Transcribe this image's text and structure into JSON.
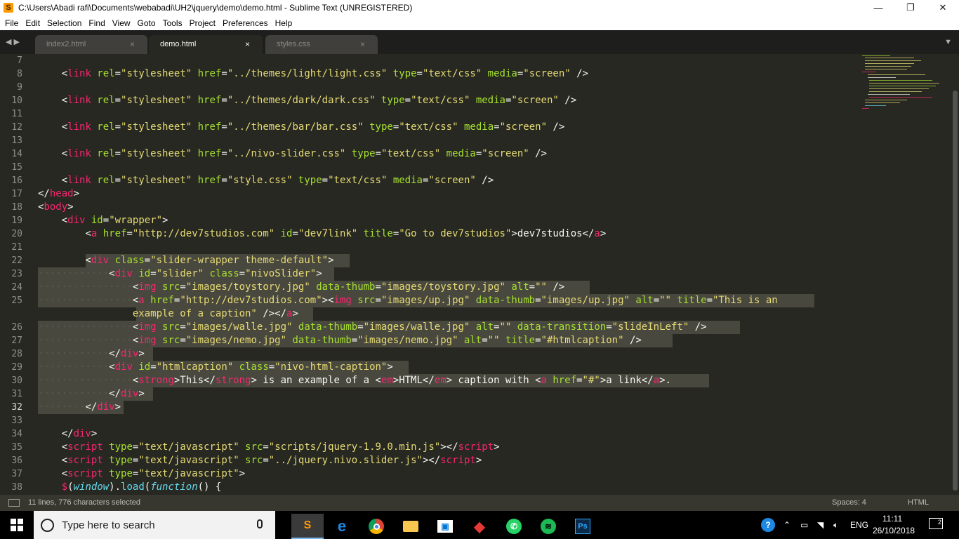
{
  "window": {
    "title": "C:\\Users\\Abadi rafi\\Documents\\webabadi\\UH2\\jquery\\demo\\demo.html - Sublime Text (UNREGISTERED)",
    "app_icon": "S",
    "minimize": "—",
    "maximize": "❐",
    "close": "✕"
  },
  "menu": [
    "File",
    "Edit",
    "Selection",
    "Find",
    "View",
    "Goto",
    "Tools",
    "Project",
    "Preferences",
    "Help"
  ],
  "tabs": [
    {
      "label": "index2.html",
      "close": "×",
      "active": false
    },
    {
      "label": "demo.html",
      "close": "×",
      "active": true
    },
    {
      "label": "styles.css",
      "close": "×",
      "active": false
    }
  ],
  "tab_nav": "◀▶",
  "tab_dropdown": "▼",
  "line_numbers": [
    "7",
    "8",
    "9",
    "10",
    "11",
    "12",
    "13",
    "14",
    "15",
    "16",
    "17",
    "18",
    "19",
    "20",
    "21",
    "22",
    "23",
    "24",
    "25",
    "",
    "26",
    "27",
    "28",
    "29",
    "30",
    "31",
    "32",
    "33",
    "34",
    "35",
    "36",
    "37",
    "38"
  ],
  "code": {
    "l8": {
      "i": "    ",
      "lt": "<",
      "tag": "link",
      "a1": " rel",
      "e1": "=",
      "v1": "\"stylesheet\"",
      "a2": " href",
      "e2": "=",
      "v2": "\"../themes/light/light.css\"",
      "a3": " type",
      "e3": "=",
      "v3": "\"text/css\"",
      "a4": " media",
      "e4": "=",
      "v4": "\"screen\"",
      "end": " />"
    },
    "l10": {
      "i": "    ",
      "lt": "<",
      "tag": "link",
      "a1": " rel",
      "e1": "=",
      "v1": "\"stylesheet\"",
      "a2": " href",
      "e2": "=",
      "v2": "\"../themes/dark/dark.css\"",
      "a3": " type",
      "e3": "=",
      "v3": "\"text/css\"",
      "a4": " media",
      "e4": "=",
      "v4": "\"screen\"",
      "end": " />"
    },
    "l12": {
      "i": "    ",
      "lt": "<",
      "tag": "link",
      "a1": " rel",
      "e1": "=",
      "v1": "\"stylesheet\"",
      "a2": " href",
      "e2": "=",
      "v2": "\"../themes/bar/bar.css\"",
      "a3": " type",
      "e3": "=",
      "v3": "\"text/css\"",
      "a4": " media",
      "e4": "=",
      "v4": "\"screen\"",
      "end": " />"
    },
    "l14": {
      "i": "    ",
      "lt": "<",
      "tag": "link",
      "a1": " rel",
      "e1": "=",
      "v1": "\"stylesheet\"",
      "a2": " href",
      "e2": "=",
      "v2": "\"../nivo-slider.css\"",
      "a3": " type",
      "e3": "=",
      "v3": "\"text/css\"",
      "a4": " media",
      "e4": "=",
      "v4": "\"screen\"",
      "end": " />"
    },
    "l16": {
      "i": "    ",
      "lt": "<",
      "tag": "link",
      "a1": " rel",
      "e1": "=",
      "v1": "\"stylesheet\"",
      "a2": " href",
      "e2": "=",
      "v2": "\"style.css\"",
      "a3": " type",
      "e3": "=",
      "v3": "\"text/css\"",
      "a4": " media",
      "e4": "=",
      "v4": "\"screen\"",
      "end": " />"
    },
    "l17": {
      "lt": "</",
      "tag": "head",
      "gt": ">"
    },
    "l18": {
      "lt": "<",
      "tag": "body",
      "gt": ">"
    },
    "l19": {
      "i": "    ",
      "lt": "<",
      "tag": "div",
      "a1": " id",
      "e1": "=",
      "v1": "\"wrapper\"",
      "gt": ">"
    },
    "l20": {
      "i": "        ",
      "lt": "<",
      "tag": "a",
      "a1": " href",
      "e1": "=",
      "v1": "\"http://dev7studios.com\"",
      "a2": " id",
      "e2": "=",
      "v2": "\"dev7link\"",
      "a3": " title",
      "e3": "=",
      "v3": "\"Go to dev7studios\"",
      "txt": ">dev7studios</",
      "tag2": "a",
      "gt": ">"
    },
    "l22": {
      "i": "        ",
      "lt": "<",
      "tag": "div",
      "a1": " class",
      "e1": "=",
      "v1": "\"slider-wrapper theme-default\"",
      "gt": ">"
    },
    "l23": {
      "i": "············",
      "lt": "<",
      "tag": "div",
      "a1": " id",
      "e1": "=",
      "v1": "\"slider\"",
      "a2": " class",
      "e2": "=",
      "v2": "\"nivoSlider\"",
      "gt": ">"
    },
    "l24": {
      "i": "················",
      "lt": "<",
      "tag": "img",
      "a1": " src",
      "e1": "=",
      "v1": "\"images/toystory.jpg\"",
      "a2": " data-thumb",
      "e2": "=",
      "v2": "\"images/toystory.jpg\"",
      "a3": " alt",
      "e3": "=",
      "v3": "\"\"",
      "end": " />"
    },
    "l25": {
      "i": "················",
      "lt": "<",
      "tag": "a",
      "a1": " href",
      "e1": "=",
      "v1": "\"http://dev7studios.com\"",
      "gt1": "><",
      "tag2": "img",
      "a2": " src",
      "e2": "=",
      "v2": "\"images/up.jpg\"",
      "a3": " data-thumb",
      "e3": "=",
      "v3": "\"images/up.jpg\"",
      "a4": " alt",
      "e4": "=",
      "v4": "\"\"",
      "a5": " title",
      "e5": "=",
      "v5": "\"This is an"
    },
    "l25b": {
      "i": "                ",
      "v": "example of a caption\"",
      "mid": " /></",
      "tag": "a",
      "gt": ">"
    },
    "l26": {
      "i": "················",
      "lt": "<",
      "tag": "img",
      "a1": " src",
      "e1": "=",
      "v1": "\"images/walle.jpg\"",
      "a2": " data-thumb",
      "e2": "=",
      "v2": "\"images/walle.jpg\"",
      "a3": " alt",
      "e3": "=",
      "v3": "\"\"",
      "a4": " data-transition",
      "e4": "=",
      "v4": "\"slideInLeft\"",
      "end": " />"
    },
    "l27": {
      "i": "················",
      "lt": "<",
      "tag": "img",
      "a1": " src",
      "e1": "=",
      "v1": "\"images/nemo.jpg\"",
      "a2": " data-thumb",
      "e2": "=",
      "v2": "\"images/nemo.jpg\"",
      "a3": " alt",
      "e3": "=",
      "v3": "\"\"",
      "a4": " title",
      "e4": "=",
      "v4": "\"#htmlcaption\"",
      "end": " />"
    },
    "l28": {
      "i": "············",
      "lt": "</",
      "tag": "div",
      "gt": ">"
    },
    "l29": {
      "i": "············",
      "lt": "<",
      "tag": "div",
      "a1": " id",
      "e1": "=",
      "v1": "\"htmlcaption\"",
      "a2": " class",
      "e2": "=",
      "v2": "\"nivo-html-caption\"",
      "gt": ">"
    },
    "l30": {
      "i": "················",
      "lt": "<",
      "tag": "strong",
      "t1": ">This</",
      "tag2": "strong",
      "t2": "> is an example of a <",
      "tag3": "em",
      "t3": ">HTML</",
      "tag4": "em",
      "t4": "> caption with <",
      "tag5": "a",
      "a1": " href",
      "e1": "=",
      "v1": "\"#\"",
      "t5": ">a link</",
      "tag6": "a",
      "t6": ">."
    },
    "l31": {
      "i": "············",
      "lt": "</",
      "tag": "div",
      "gt": ">"
    },
    "l32": {
      "i": "········",
      "lt": "</",
      "tag": "div",
      "gt": ">"
    },
    "l34": {
      "i": "    ",
      "lt": "</",
      "tag": "div",
      "gt": ">"
    },
    "l35": {
      "i": "    ",
      "lt": "<",
      "tag": "script",
      "a1": " type",
      "e1": "=",
      "v1": "\"text/javascript\"",
      "a2": " src",
      "e2": "=",
      "v2": "\"scripts/jquery-1.9.0.min.js\"",
      "mid": "></",
      "tag2": "script",
      "gt": ">"
    },
    "l36": {
      "i": "    ",
      "lt": "<",
      "tag": "script",
      "a1": " type",
      "e1": "=",
      "v1": "\"text/javascript\"",
      "a2": " src",
      "e2": "=",
      "v2": "\"../jquery.nivo.slider.js\"",
      "mid": "></",
      "tag2": "script",
      "gt": ">"
    },
    "l37": {
      "i": "    ",
      "lt": "<",
      "tag": "script",
      "a1": " type",
      "e1": "=",
      "v1": "\"text/javascript\"",
      "gt": ">"
    },
    "l38": {
      "i": "    ",
      "d": "$",
      "p1": "(",
      "w": "window",
      "p2": ").",
      "ld": "load",
      "p3": "(",
      "fn": "function",
      "p4": "() {"
    }
  },
  "status": {
    "selection": "11 lines, 776 characters selected",
    "spaces": "Spaces: 4",
    "syntax": "HTML"
  },
  "taskbar": {
    "search_placeholder": "Type here to search",
    "apps": [
      {
        "name": "sublime-text-icon",
        "glyph": "S",
        "color": "#ff9800",
        "active": true
      },
      {
        "name": "edge-icon",
        "glyph": "e",
        "color": "#1e88e5",
        "active": false
      },
      {
        "name": "chrome-icon",
        "glyph": "●",
        "color": "#e53935",
        "active": false
      },
      {
        "name": "file-explorer-icon",
        "glyph": "▬",
        "color": "#f9c74f",
        "active": false
      },
      {
        "name": "store-icon",
        "glyph": "▣",
        "color": "#ffffff",
        "active": false
      },
      {
        "name": "garena-icon",
        "glyph": "◆",
        "color": "#e53935",
        "active": false
      },
      {
        "name": "whatsapp-icon",
        "glyph": "✆",
        "color": "#25d366",
        "active": false
      },
      {
        "name": "spotify-icon",
        "glyph": "≋",
        "color": "#1db954",
        "active": false
      },
      {
        "name": "photoshop-icon",
        "glyph": "Ps",
        "color": "#0b5aa8",
        "active": false
      }
    ],
    "language": "ENG",
    "time": "11:11",
    "date": "26/10/2018",
    "notifications": "2"
  }
}
